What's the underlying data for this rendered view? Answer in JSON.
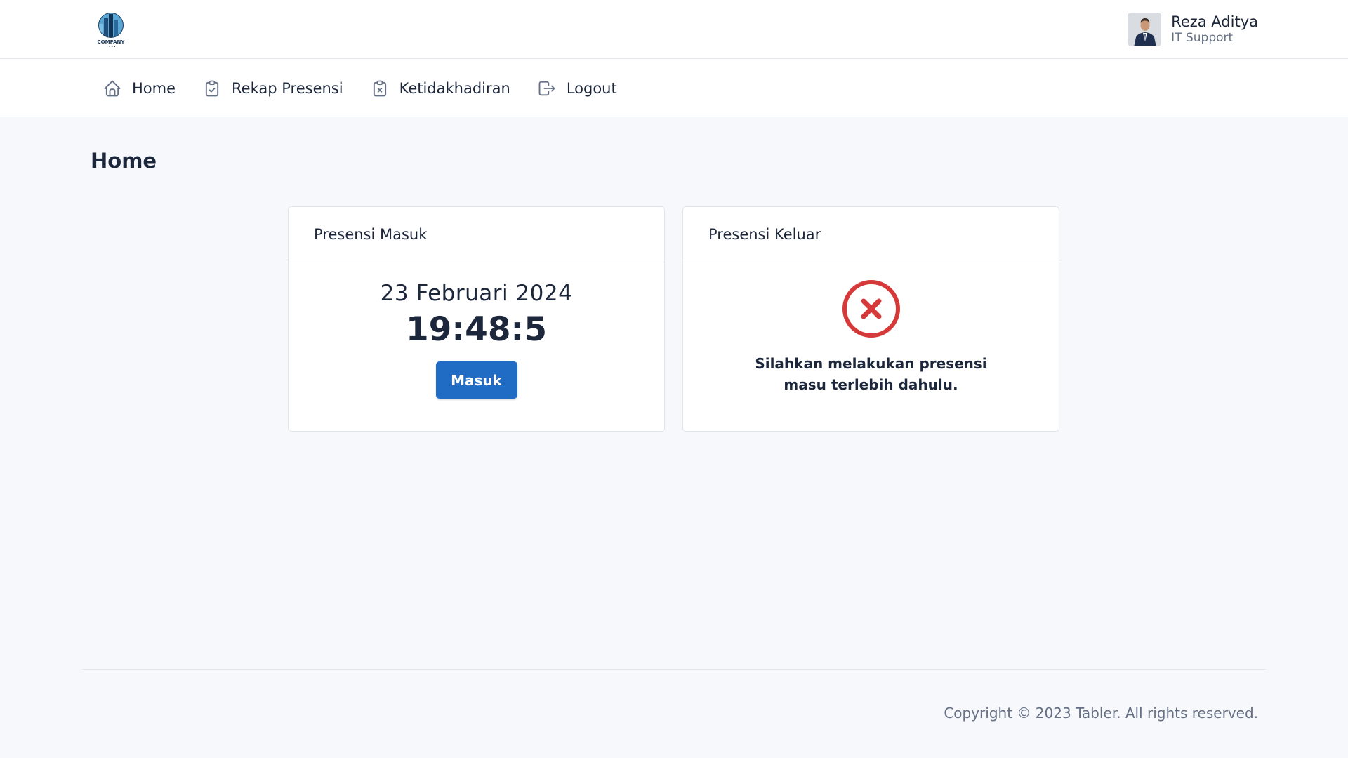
{
  "header": {
    "logo_text": "COMPANY",
    "user": {
      "name": "Reza Aditya",
      "role": "IT Support"
    }
  },
  "nav": {
    "items": [
      {
        "label": "Home",
        "icon": "home-icon"
      },
      {
        "label": "Rekap Presensi",
        "icon": "clipboard-check-icon"
      },
      {
        "label": "Ketidakhadiran",
        "icon": "clipboard-x-icon"
      },
      {
        "label": "Logout",
        "icon": "logout-icon"
      }
    ]
  },
  "page": {
    "title": "Home"
  },
  "presensi_masuk": {
    "title": "Presensi Masuk",
    "date": "23 Februari 2024",
    "time": "19:48:5",
    "button_label": "Masuk"
  },
  "presensi_keluar": {
    "title": "Presensi Keluar",
    "status_icon": "error-x-circle-icon",
    "message": "Silahkan melakukan presensi masu terlebih dahulu."
  },
  "footer": {
    "copyright": "Copyright © 2023 Tabler. All rights reserved."
  },
  "colors": {
    "primary": "#206bc4",
    "danger": "#d63939",
    "background": "#f6f8fb",
    "text": "#1d273b",
    "muted": "#667085"
  }
}
